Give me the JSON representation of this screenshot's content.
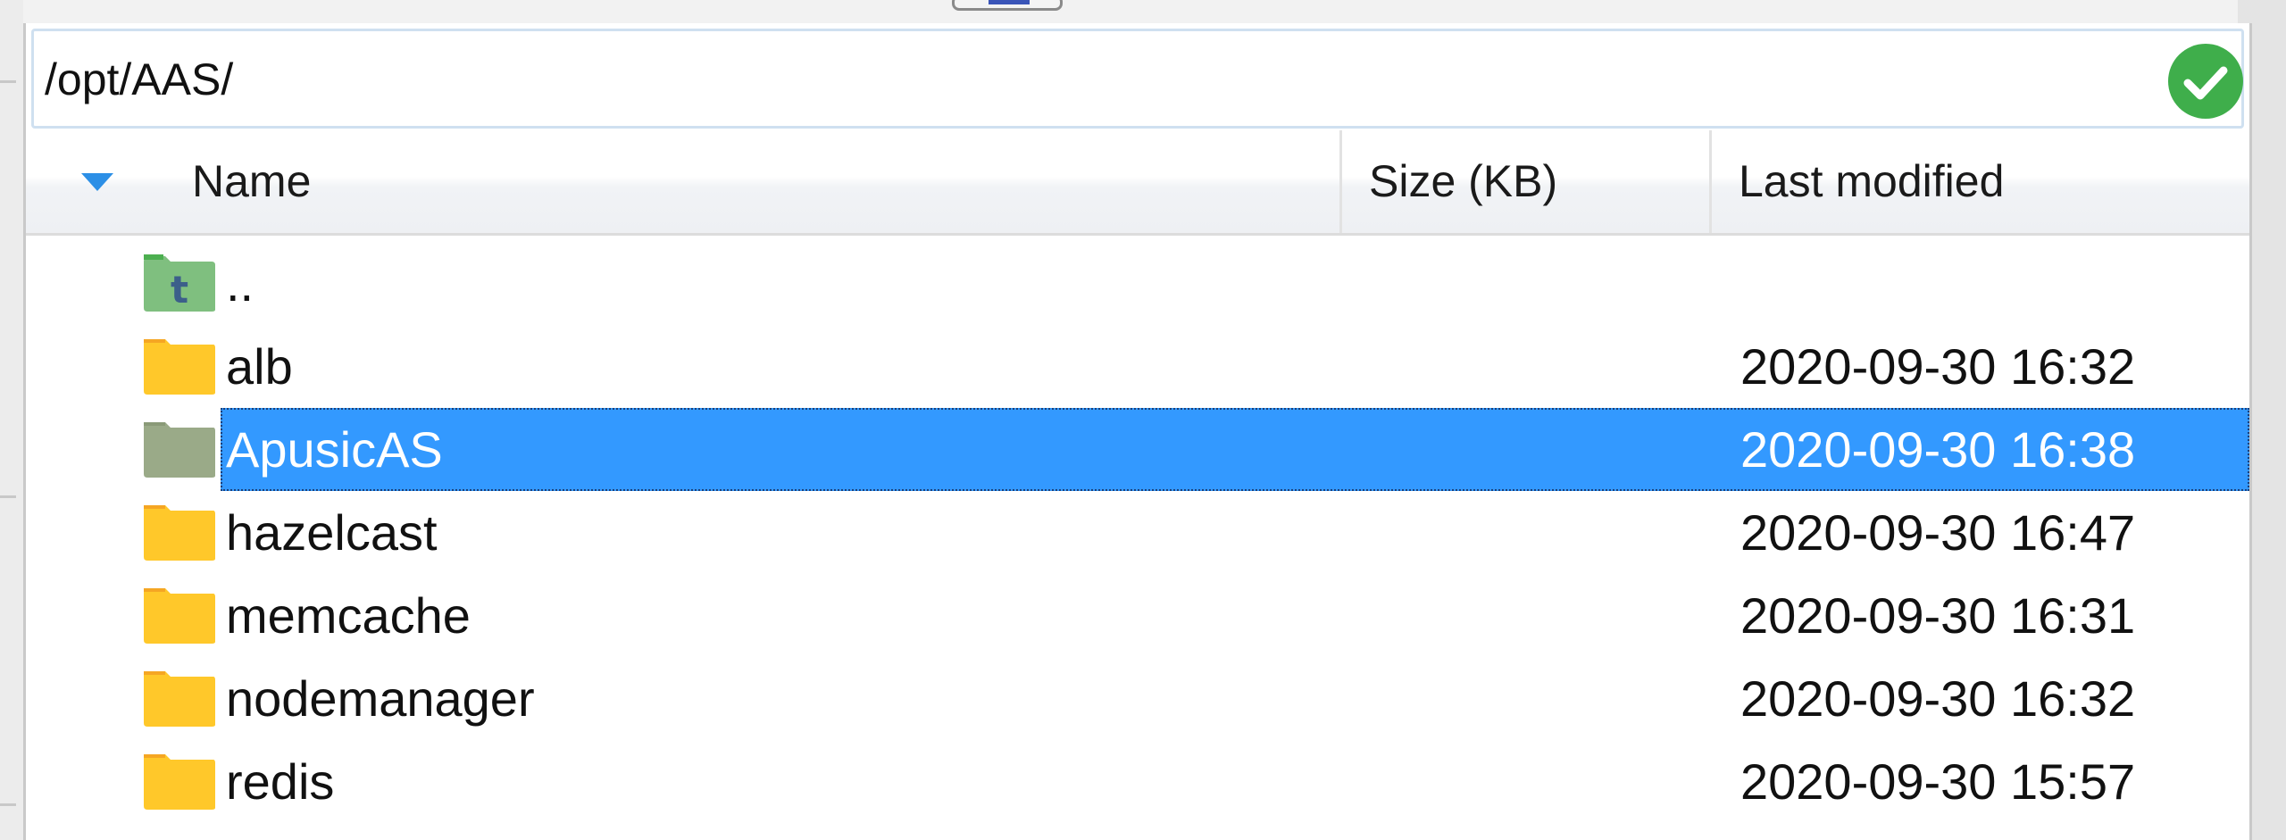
{
  "path_bar": {
    "value": "/opt/AAS/",
    "status_icon": "check-circle-icon",
    "status_color": "#3fae4b"
  },
  "columns": {
    "name": "Name",
    "size": "Size (KB)",
    "modified": "Last modified",
    "sort_color": "#2c8fe6"
  },
  "files": [
    {
      "name": "..",
      "icon": "parent-directory-icon",
      "modified": ""
    },
    {
      "name": "alb",
      "icon": "folder-icon",
      "modified": "2020-09-30 16:32"
    },
    {
      "name": "ApusicAS",
      "icon": "folder-icon",
      "modified": "2020-09-30 16:38",
      "selected": true
    },
    {
      "name": "hazelcast",
      "icon": "folder-icon",
      "modified": "2020-09-30 16:47"
    },
    {
      "name": "memcache",
      "icon": "folder-icon",
      "modified": "2020-09-30 16:31"
    },
    {
      "name": "nodemanager",
      "icon": "folder-icon",
      "modified": "2020-09-30 16:32"
    },
    {
      "name": "redis",
      "icon": "folder-icon",
      "modified": "2020-09-30 15:57"
    }
  ],
  "colors": {
    "selection": "#3399ff",
    "folder": "#ffc82a",
    "parent_folder": "#7fbf7f"
  }
}
